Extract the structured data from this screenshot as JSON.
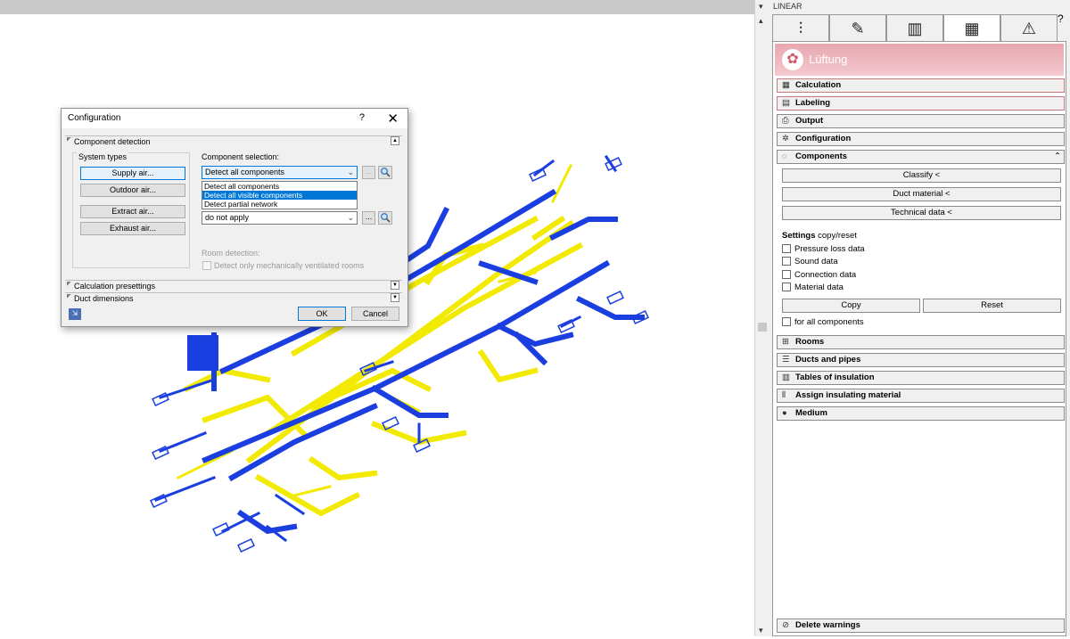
{
  "panel": {
    "title": "LINEAR",
    "help_icon": "question-icon",
    "tabs": [
      {
        "icon": "sliders-icon",
        "glyph": "⫶"
      },
      {
        "icon": "pencil-icon",
        "glyph": "✎"
      },
      {
        "icon": "library-icon",
        "glyph": "▥"
      },
      {
        "icon": "grid-icon",
        "glyph": "▦"
      },
      {
        "icon": "warning-icon",
        "glyph": "⚠"
      }
    ],
    "module_name": "Lüftung",
    "sections": {
      "calculation": "Calculation",
      "labeling": "Labeling",
      "output": "Output",
      "configuration": "Configuration",
      "components": "Components",
      "rooms": "Rooms",
      "ducts_pipes": "Ducts and pipes",
      "tables_insulation": "Tables of insulation",
      "assign_insulation": "Assign insulating material",
      "medium": "Medium"
    },
    "components": {
      "classify": "Classify  <",
      "duct_material": "Duct material  <",
      "technical_data": "Technical data  <",
      "settings_bold": "Settings",
      "settings_rest": " copy/reset",
      "checkboxes": [
        "Pressure loss data",
        "Sound data",
        "Connection data",
        "Material data"
      ],
      "copy": "Copy",
      "reset": "Reset",
      "for_all": "for all components"
    },
    "delete_warnings": "Delete warnings"
  },
  "dialog": {
    "title": "Configuration",
    "help": "?",
    "close": "✕",
    "group_component_detection": "Component detection",
    "system_types_caption": "System types",
    "system_buttons": [
      "Supply air...",
      "Outdoor air...",
      "Extract air...",
      "Exhaust air..."
    ],
    "component_selection_label": "Component selection:",
    "component_selection_value": "Detect all components",
    "dropdown_options": [
      "Detect all components",
      "Detect all visible components",
      "Detect partial network"
    ],
    "dropdown_selected_index": 1,
    "second_combo_value": "do not apply",
    "dots": "...",
    "room_detection_label": "Room detection:",
    "room_detection_check": "Detect only mechanically ventilated rooms",
    "group_calc_presettings": "Calculation presettings",
    "group_duct_dimensions": "Duct dimensions",
    "ok": "OK",
    "cancel": "Cancel"
  }
}
